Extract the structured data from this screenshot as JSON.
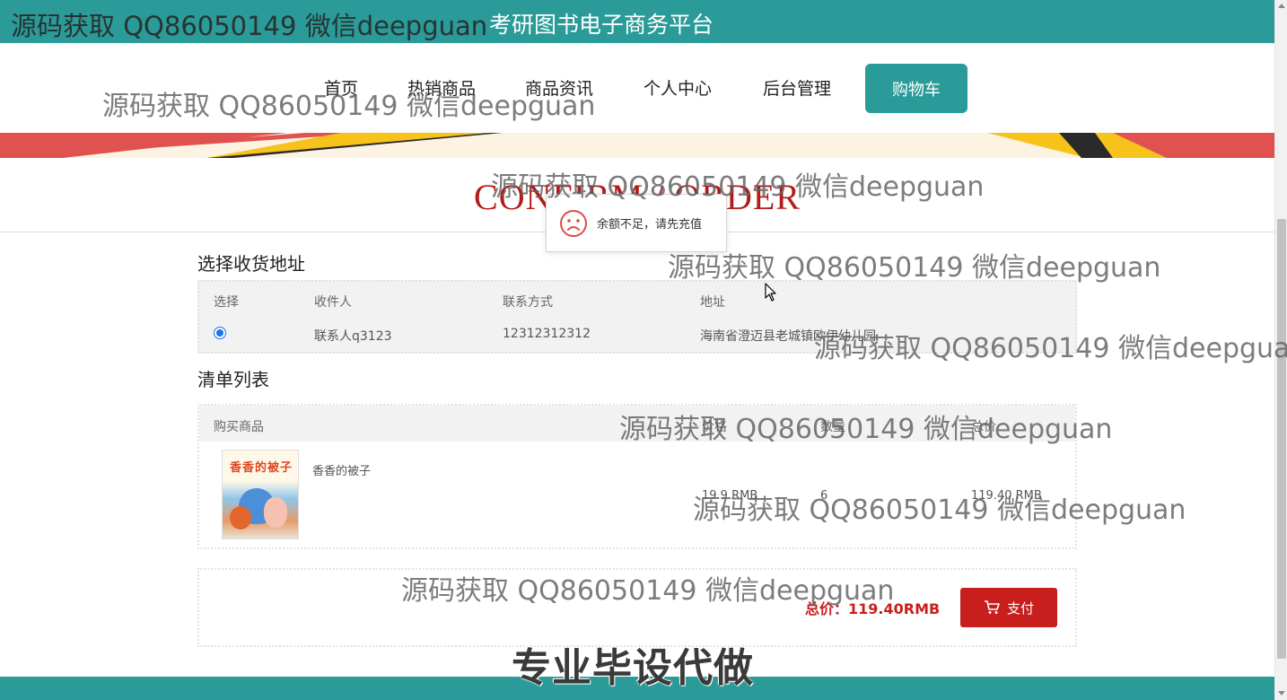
{
  "header": {
    "site_title": "考研图书电子商务平台",
    "brand_color": "#2a9b98"
  },
  "nav": {
    "items": [
      {
        "label": "首页"
      },
      {
        "label": "热销商品"
      },
      {
        "label": "商品资讯"
      },
      {
        "label": "个人中心"
      },
      {
        "label": "后台管理"
      }
    ],
    "cart_label": "购物车"
  },
  "page": {
    "heading": "CONFIRM / ORDER"
  },
  "toast": {
    "icon": "sad-face-icon",
    "message": "余额不足，请先充值"
  },
  "address_section": {
    "title": "选择收货地址",
    "columns": [
      "选择",
      "收件人",
      "联系方式",
      "地址"
    ],
    "rows": [
      {
        "selected": true,
        "recipient": "联系人q3123",
        "phone": "12312312312",
        "address": "海南省澄迈县老城镇欧伊幼儿园"
      }
    ]
  },
  "items_section": {
    "title": "清单列表",
    "columns": [
      "购买商品",
      "价格",
      "数量",
      "总价"
    ],
    "rows": [
      {
        "name": "香香的被子",
        "cover_title": "香香的被子",
        "price": "19.9 RMB",
        "quantity": "6",
        "subtotal": "119.40 RMB"
      }
    ]
  },
  "summary": {
    "total_label": "总价：119.40RMB",
    "pay_label": "支付",
    "pay_color": "#c81e1e"
  },
  "overlay": {
    "watermark": "源码获取 QQ86050149 微信deepguan",
    "promo": "专业毕设代做"
  }
}
